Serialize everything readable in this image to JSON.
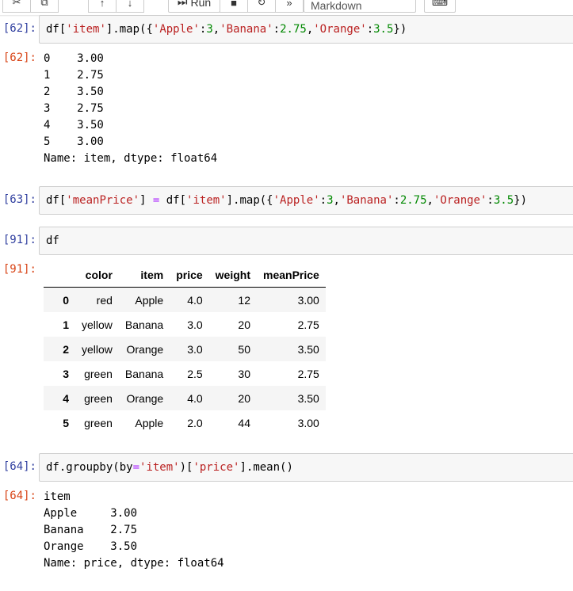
{
  "toolbar": {
    "run_label": "Run",
    "cell_type": "Markdown"
  },
  "cells": [
    {
      "in_prompt": "[62]:",
      "code": [
        {
          "t": "df[",
          "c": "p"
        },
        {
          "t": "'item'",
          "c": "s"
        },
        {
          "t": "].map({",
          "c": "p"
        },
        {
          "t": "'Apple'",
          "c": "s"
        },
        {
          "t": ":",
          "c": "p"
        },
        {
          "t": "3",
          "c": "n"
        },
        {
          "t": ",",
          "c": "p"
        },
        {
          "t": "'Banana'",
          "c": "s"
        },
        {
          "t": ":",
          "c": "p"
        },
        {
          "t": "2.75",
          "c": "n"
        },
        {
          "t": ",",
          "c": "p"
        },
        {
          "t": "'Orange'",
          "c": "s"
        },
        {
          "t": ":",
          "c": "p"
        },
        {
          "t": "3.5",
          "c": "n"
        },
        {
          "t": "})",
          "c": "p"
        }
      ],
      "out_prompt": "[62]:",
      "output": "0    3.00\n1    2.75\n2    3.50\n3    2.75\n4    3.50\n5    3.00\nName: item, dtype: float64"
    },
    {
      "in_prompt": "[63]:",
      "code": [
        {
          "t": "df[",
          "c": "p"
        },
        {
          "t": "'meanPrice'",
          "c": "s"
        },
        {
          "t": "] ",
          "c": "p"
        },
        {
          "t": "=",
          "c": "o"
        },
        {
          "t": " df[",
          "c": "p"
        },
        {
          "t": "'item'",
          "c": "s"
        },
        {
          "t": "].map({",
          "c": "p"
        },
        {
          "t": "'Apple'",
          "c": "s"
        },
        {
          "t": ":",
          "c": "p"
        },
        {
          "t": "3",
          "c": "n"
        },
        {
          "t": ",",
          "c": "p"
        },
        {
          "t": "'Banana'",
          "c": "s"
        },
        {
          "t": ":",
          "c": "p"
        },
        {
          "t": "2.75",
          "c": "n"
        },
        {
          "t": ",",
          "c": "p"
        },
        {
          "t": "'Orange'",
          "c": "s"
        },
        {
          "t": ":",
          "c": "p"
        },
        {
          "t": "3.5",
          "c": "n"
        },
        {
          "t": "})",
          "c": "p"
        }
      ]
    },
    {
      "in_prompt": "[91]:",
      "code": [
        {
          "t": "df",
          "c": "p"
        }
      ],
      "out_prompt": "[91]:",
      "table": {
        "columns": [
          "",
          "color",
          "item",
          "price",
          "weight",
          "meanPrice"
        ],
        "rows": [
          [
            "0",
            "red",
            "Apple",
            "4.0",
            "12",
            "3.00"
          ],
          [
            "1",
            "yellow",
            "Banana",
            "3.0",
            "20",
            "2.75"
          ],
          [
            "2",
            "yellow",
            "Orange",
            "3.0",
            "50",
            "3.50"
          ],
          [
            "3",
            "green",
            "Banana",
            "2.5",
            "30",
            "2.75"
          ],
          [
            "4",
            "green",
            "Orange",
            "4.0",
            "20",
            "3.50"
          ],
          [
            "5",
            "green",
            "Apple",
            "2.0",
            "44",
            "3.00"
          ]
        ]
      }
    },
    {
      "in_prompt": "[64]:",
      "code": [
        {
          "t": "df.groupby(by",
          "c": "p"
        },
        {
          "t": "=",
          "c": "o"
        },
        {
          "t": "'item'",
          "c": "s"
        },
        {
          "t": ")[",
          "c": "p"
        },
        {
          "t": "'price'",
          "c": "s"
        },
        {
          "t": "].mean()",
          "c": "p"
        }
      ],
      "out_prompt": "[64]:",
      "output": "item\nApple     3.00\nBanana    2.75\nOrange    3.50\nName: price, dtype: float64"
    }
  ]
}
